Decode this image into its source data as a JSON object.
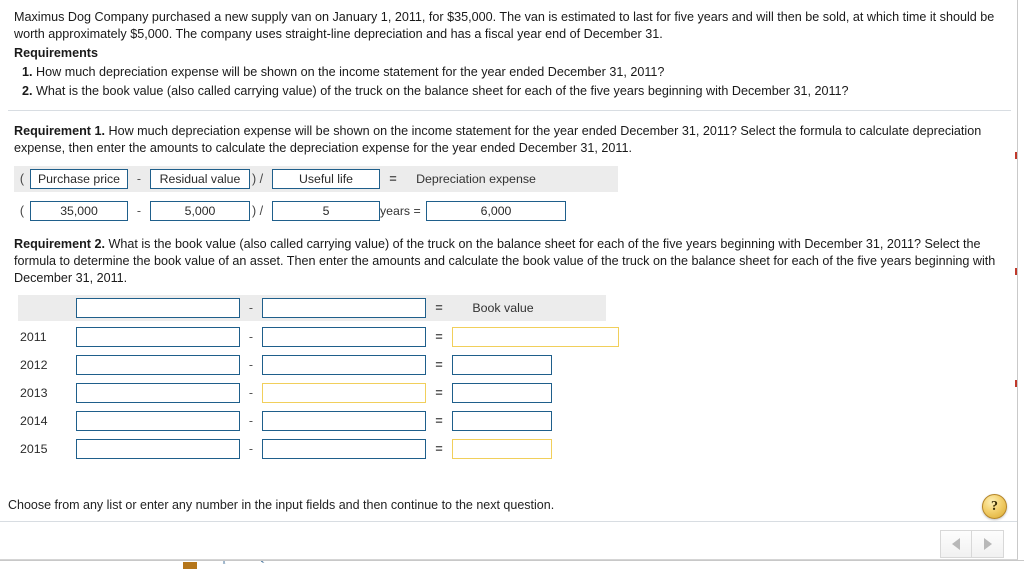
{
  "problem": {
    "paragraph": "Maximus Dog Company purchased a new supply van on January 1, 2011, for $35,000. The van is estimated to last for five years and will then be sold, at which time it should be worth approximately $5,000. The company uses straight-line depreciation and has a fiscal year end of December 31.",
    "requirements_heading": "Requirements",
    "requirements": [
      {
        "number": "1.",
        "text": "How much depreciation expense will be shown on the income statement for the year ended December 31, 2011?"
      },
      {
        "number": "2.",
        "text": "What is the book value (also called carrying value) of the truck on the balance sheet for each of the five years beginning with December 31, 2011?"
      }
    ]
  },
  "requirement1": {
    "lead": "Requirement 1.",
    "text": " How much depreciation expense will be shown on the income statement for the year ended December 31, 2011? Select the formula to calculate depreciation expense, then enter the amounts to calculate the depreciation expense for the year ended December 31, 2011.",
    "header": {
      "open_paren": "(",
      "purchase_price": "Purchase price",
      "minus": "-",
      "residual_value": "Residual value",
      "close_paren_divide": ") /",
      "useful_life": "Useful life",
      "equals": "=",
      "result_label": "Depreciation expense"
    },
    "values": {
      "open_paren": "(",
      "purchase_price": "35,000",
      "minus": "-",
      "residual_value": "5,000",
      "close_paren_divide": ") /",
      "useful_life": "5",
      "years_equals": "years =",
      "depreciation_expense": "6,000"
    }
  },
  "requirement2": {
    "lead": "Requirement 2.",
    "text": " What is the book value (also called carrying value) of the truck on the balance sheet for each of the five years beginning with December 31, 2011? Select the formula to determine the book value of an asset. Then enter the amounts and calculate the book value of the truck on the balance sheet for each of the five years beginning with December 31, 2011.",
    "table": {
      "header": {
        "year_label": "",
        "col1": "",
        "minus": "-",
        "col2": "",
        "equals": "=",
        "result_label": "Book value"
      },
      "rows": [
        {
          "year": "2011",
          "col1": "",
          "minus": "-",
          "col2": "",
          "equals": "=",
          "book_value": "",
          "col1_state": "normal",
          "col2_state": "normal",
          "book_value_state": "highlighted-wide"
        },
        {
          "year": "2012",
          "col1": "",
          "minus": "-",
          "col2": "",
          "equals": "=",
          "book_value": "",
          "col1_state": "normal",
          "col2_state": "normal",
          "book_value_state": "normal"
        },
        {
          "year": "2013",
          "col1": "",
          "minus": "-",
          "col2": "",
          "equals": "=",
          "book_value": "",
          "col1_state": "normal",
          "col2_state": "highlighted",
          "book_value_state": "normal"
        },
        {
          "year": "2014",
          "col1": "",
          "minus": "-",
          "col2": "",
          "equals": "=",
          "book_value": "",
          "col1_state": "normal",
          "col2_state": "normal",
          "book_value_state": "normal"
        },
        {
          "year": "2015",
          "col1": "",
          "minus": "-",
          "col2": "",
          "equals": "=",
          "book_value": "",
          "col1_state": "normal",
          "col2_state": "normal",
          "book_value_state": "highlighted"
        }
      ]
    }
  },
  "footer": {
    "instruction": "Choose from any list or enter any number in the input fields and then continue to the next question.",
    "help_label": "?",
    "prev_label": "◀",
    "next_label": "▶"
  },
  "colors": {
    "field_border": "#1f5f8b",
    "field_border_highlight": "#f1cf5b",
    "header_band": "#ececec",
    "separator": "#d8dde2",
    "help_badge": "#f4d271"
  }
}
